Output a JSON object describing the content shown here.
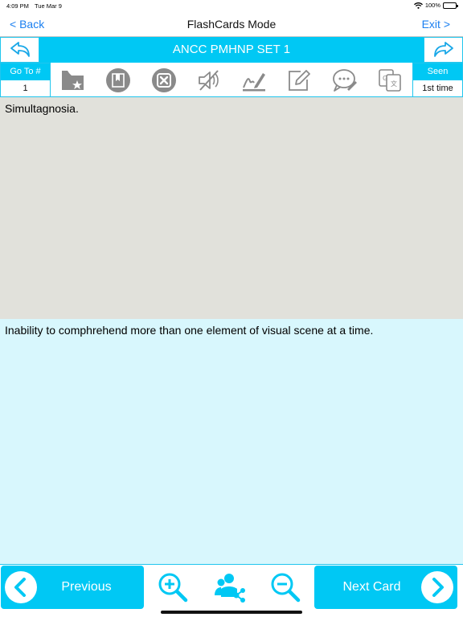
{
  "status_bar": {
    "time": "4:09 PM",
    "date": "Tue Mar 9",
    "battery": "100%"
  },
  "nav": {
    "back_label": "< Back",
    "title": "FlashCards Mode",
    "exit_label": "Exit >"
  },
  "set": {
    "title": "ANCC PMHNP SET 1"
  },
  "toolbar": {
    "goto_label": "Go To #",
    "goto_value": "1",
    "seen_label": "Seen",
    "seen_value": "1st time",
    "icons": [
      "folder-star-icon",
      "bookmark-icon",
      "close-icon",
      "mute-icon",
      "signature-icon",
      "edit-icon",
      "chat-icon",
      "translate-icon"
    ]
  },
  "card": {
    "question": "Simultagnosia.",
    "answer": "Inability to comphrehend more than one element of visual scene at a time."
  },
  "bottom": {
    "previous_label": "Previous",
    "next_label": "Next Card"
  },
  "colors": {
    "accent": "#00c8f4",
    "link": "#1a7ff0",
    "question_bg": "#e1e1db",
    "answer_bg": "#d8f7fd",
    "icon_gray": "#8a8a8a"
  }
}
